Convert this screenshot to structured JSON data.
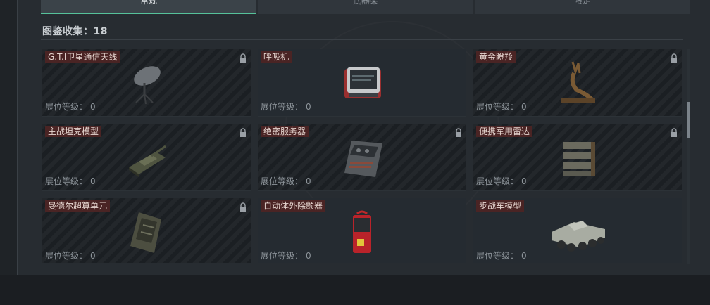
{
  "tabs": [
    {
      "label": "常规",
      "active": true
    },
    {
      "label": "武器架",
      "active": false
    },
    {
      "label": "限定",
      "active": false
    }
  ],
  "collection": {
    "header": "图鉴收集：18"
  },
  "level_label": "展位等级：",
  "cards": [
    {
      "name": "G.T.I卫星通信天线",
      "level": "0",
      "locked": true,
      "icon": "satellite-dish-icon"
    },
    {
      "name": "呼吸机",
      "level": "0",
      "locked": false,
      "icon": "ventilator-icon"
    },
    {
      "name": "黄金瞪羚",
      "level": "0",
      "locked": true,
      "icon": "golden-gazelle-icon"
    },
    {
      "name": "主战坦克模型",
      "level": "0",
      "locked": true,
      "icon": "tank-model-icon"
    },
    {
      "name": "绝密服务器",
      "level": "0",
      "locked": true,
      "icon": "server-icon"
    },
    {
      "name": "便携军用雷达",
      "level": "0",
      "locked": true,
      "icon": "radar-icon"
    },
    {
      "name": "曼德尔超算单元",
      "level": "0",
      "locked": true,
      "icon": "supercomputer-icon"
    },
    {
      "name": "自动体外除颤器",
      "level": "0",
      "locked": false,
      "icon": "defibrillator-icon"
    },
    {
      "name": "步战车模型",
      "level": "0",
      "locked": false,
      "icon": "ifv-model-icon"
    }
  ],
  "colors": {
    "accent": "#56c29a",
    "name_tag": "#4a2424",
    "panel": "#272c31"
  }
}
